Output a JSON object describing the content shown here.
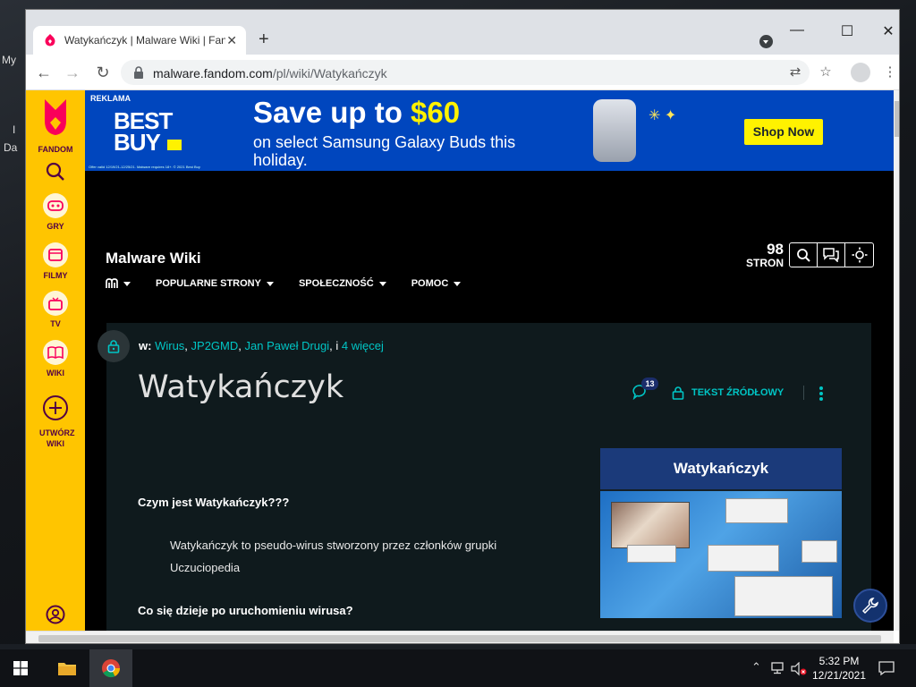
{
  "desktop": {
    "labels": [
      "My",
      "I",
      "Da"
    ]
  },
  "browser": {
    "tab_title": "Watykańczyk | Malware Wiki | Fandom",
    "new_tab_icon": "plus-icon",
    "url_host": "malware.fandom.com",
    "url_path": "/pl/wiki/Watykańczyk"
  },
  "rail": {
    "brand": "FANDOM",
    "items": [
      {
        "label": "GRY",
        "icon": "gamepad-icon"
      },
      {
        "label": "FILMY",
        "icon": "film-icon"
      },
      {
        "label": "TV",
        "icon": "tv-icon"
      },
      {
        "label": "WIKI",
        "icon": "book-icon"
      }
    ],
    "create_label": "UTWÓRZ WIKI"
  },
  "ad": {
    "tag": "REKLAMA",
    "logo_line1": "BEST",
    "logo_line2": "BUY",
    "headline_a": "Save up to ",
    "headline_b": "$60",
    "subline": "on select Samsung Galaxy Buds this holiday.",
    "cta": "Shop Now",
    "fine_print": "Offer valid 12/19/21-12/25/21. Malware requires 18+. © 2021 Best Buy",
    "brand_color": "#0046be",
    "accent": "#fff200"
  },
  "community": {
    "name": "Malware Wiki",
    "page_count": "98",
    "page_count_label": "STRON",
    "nav": [
      "POPULARNE STRONY",
      "SPOŁECZNOŚĆ",
      "POMOC"
    ]
  },
  "article": {
    "cats_prefix": "w:",
    "cats": [
      "Wirus",
      "JP2GMD",
      "Jan Paweł Drugi"
    ],
    "cats_more": "4 więcej",
    "cats_sep": ", i ",
    "title": "Watykańczyk",
    "comment_count": "13",
    "source_label": "TEKST ŹRÓDŁOWY",
    "heading1": "Czym jest Watykańczyk???",
    "paragraph1": "Watykańczyk to pseudo-wirus stworzony przez członków grupki Uczuciopedia",
    "heading2": "Co się dzieje po uruchomieniu wirusa?",
    "infobox_title": "Watykańczyk"
  },
  "taskbar": {
    "time": "5:32 PM",
    "date": "12/21/2021"
  }
}
